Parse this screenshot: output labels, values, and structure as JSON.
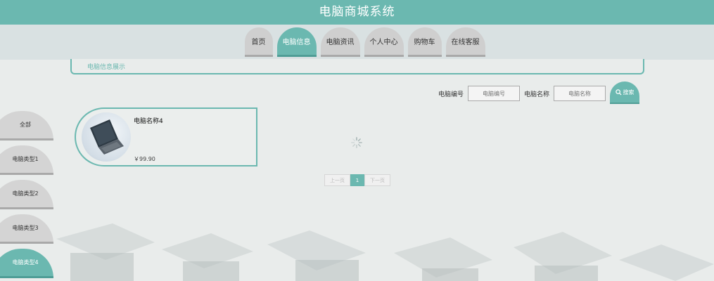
{
  "header": {
    "title": "电脑商城系统"
  },
  "nav": {
    "tabs": [
      {
        "label": "首页",
        "active": false
      },
      {
        "label": "电脑信息",
        "active": true
      },
      {
        "label": "电脑资讯",
        "active": false
      },
      {
        "label": "个人中心",
        "active": false
      },
      {
        "label": "购物车",
        "active": false
      },
      {
        "label": "在线客服",
        "active": false
      }
    ]
  },
  "section": {
    "label": "电脑信息展示"
  },
  "search": {
    "field1_label": "电脑编号",
    "field1_placeholder": "电脑编号",
    "field2_label": "电脑名称",
    "field2_placeholder": "电脑名称",
    "button_label": "搜索"
  },
  "sidebar": {
    "items": [
      {
        "label": "全部",
        "active": false
      },
      {
        "label": "电脑类型1",
        "active": false
      },
      {
        "label": "电脑类型2",
        "active": false
      },
      {
        "label": "电脑类型3",
        "active": false
      },
      {
        "label": "电脑类型4",
        "active": true
      }
    ]
  },
  "products": [
    {
      "name": "电脑名称4",
      "price": "￥99.90",
      "icon": "laptop-image"
    }
  ],
  "pagination": {
    "prev": "上一页",
    "current": "1",
    "next": "下一页"
  },
  "colors": {
    "accent": "#6bb8b0",
    "accent_dark": "#4f9d96",
    "tab_inactive": "#cfcfcf",
    "background": "#e9eceb"
  }
}
